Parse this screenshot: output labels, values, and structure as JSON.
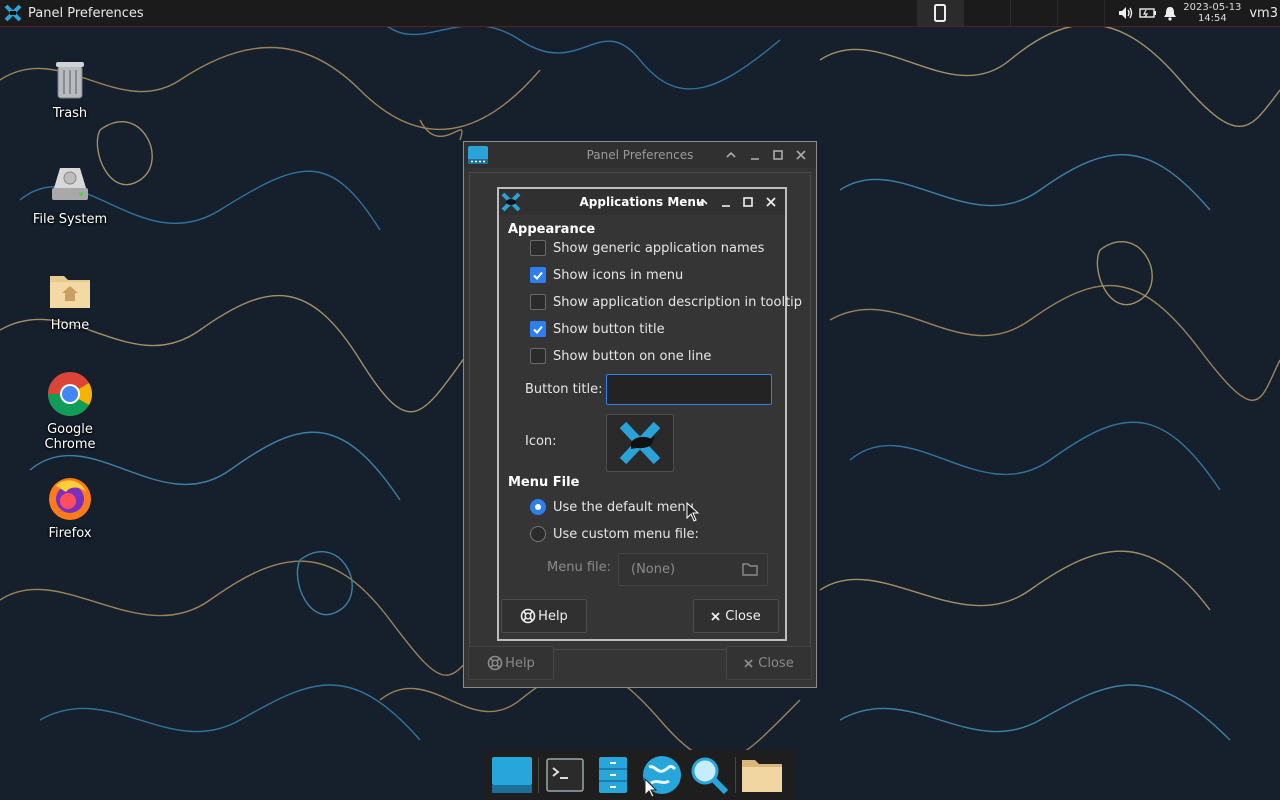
{
  "top_panel": {
    "active_window_title": "Panel Preferences",
    "clock": {
      "date": "2023-05-13",
      "time": "14:54"
    },
    "user": "vm3",
    "tray_icons": [
      "volume-icon",
      "battery-icon",
      "notification-bell-icon"
    ]
  },
  "desktop_icons": [
    {
      "label": "Trash",
      "icon": "trash-icon"
    },
    {
      "label": "File System",
      "icon": "drive-icon"
    },
    {
      "label": "Home",
      "icon": "home-folder-icon"
    },
    {
      "label": "Google Chrome",
      "icon": "chrome-icon"
    },
    {
      "label": "Firefox",
      "icon": "firefox-icon"
    }
  ],
  "panel_preferences": {
    "title": "Panel Preferences",
    "help_label": "Help",
    "close_label": "Close"
  },
  "applications_menu_dialog": {
    "title": "Applications Menu",
    "appearance": {
      "heading": "Appearance",
      "options": [
        {
          "label": "Show generic application names",
          "checked": false
        },
        {
          "label": "Show icons in menu",
          "checked": true
        },
        {
          "label": "Show application description in tooltip",
          "checked": false
        },
        {
          "label": "Show button title",
          "checked": true
        },
        {
          "label": "Show button on one line",
          "checked": false
        }
      ],
      "button_title_label": "Button title:",
      "button_title_value": "",
      "icon_label": "Icon:"
    },
    "menu_file": {
      "heading": "Menu File",
      "default_menu_label": "Use the default menu",
      "default_menu_selected": true,
      "custom_menu_label": "Use custom menu file:",
      "custom_menu_selected": false,
      "menu_file_label": "Menu file:",
      "menu_file_value": "(None)"
    },
    "help_label": "Help",
    "close_label": "Close"
  },
  "colors": {
    "accent": "#2d7ff0",
    "panel_bg": "#1b1b1b",
    "window_bg": "#353535"
  }
}
